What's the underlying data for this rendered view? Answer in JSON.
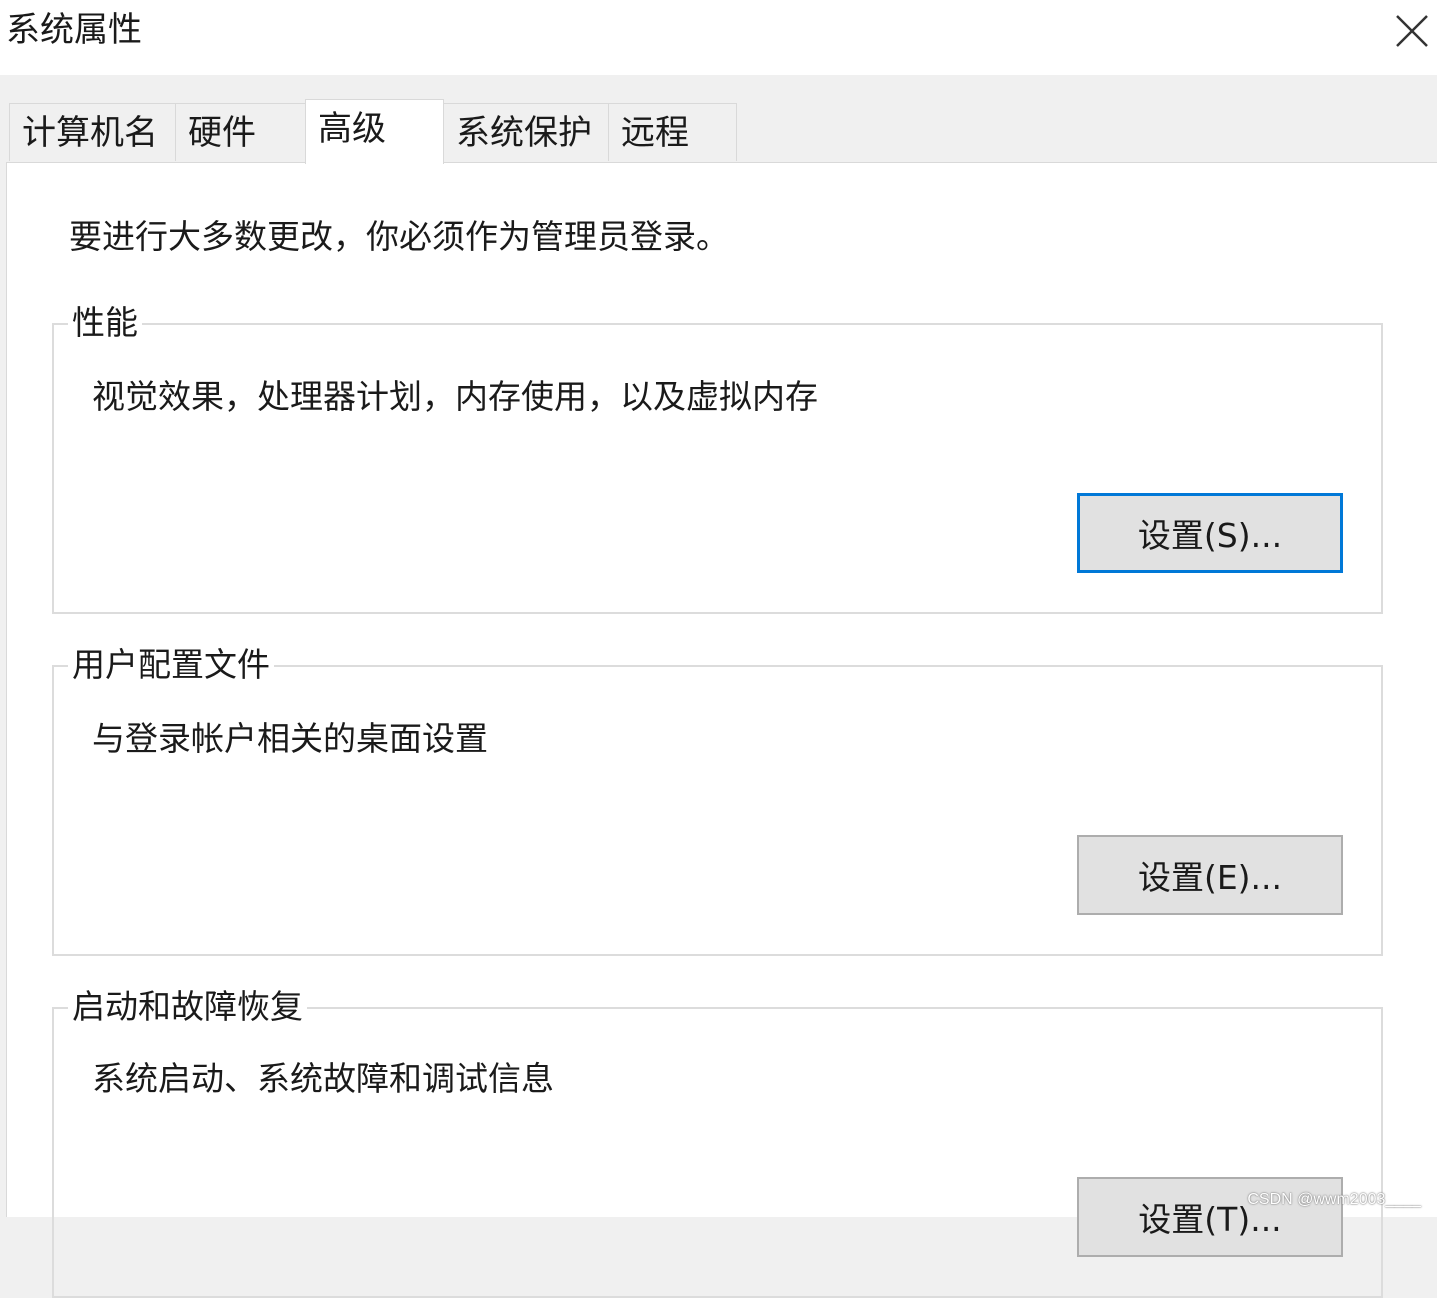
{
  "window": {
    "title": "系统属性",
    "close_icon": "close-icon"
  },
  "tabs": [
    {
      "label": "计算机名",
      "active": false
    },
    {
      "label": "硬件",
      "active": false
    },
    {
      "label": "高级",
      "active": true
    },
    {
      "label": "系统保护",
      "active": false
    },
    {
      "label": "远程",
      "active": false
    }
  ],
  "advanced": {
    "notice": "要进行大多数更改，你必须作为管理员登录。",
    "performance": {
      "legend": "性能",
      "description": "视觉效果，处理器计划，内存使用，以及虚拟内存",
      "button": "设置(S)..."
    },
    "user_profiles": {
      "legend": "用户配置文件",
      "description": "与登录帐户相关的桌面设置",
      "button": "设置(E)..."
    },
    "startup_recovery": {
      "legend": "启动和故障恢复",
      "description": "系统启动、系统故障和调试信息",
      "button": "设置(T)..."
    }
  },
  "watermark": "CSDN @wwm2003____",
  "colors": {
    "focus_border": "#0078d7",
    "button_face": "#e1e1e1",
    "panel_bg": "#ffffff",
    "dialog_bg": "#f0f0f0"
  }
}
